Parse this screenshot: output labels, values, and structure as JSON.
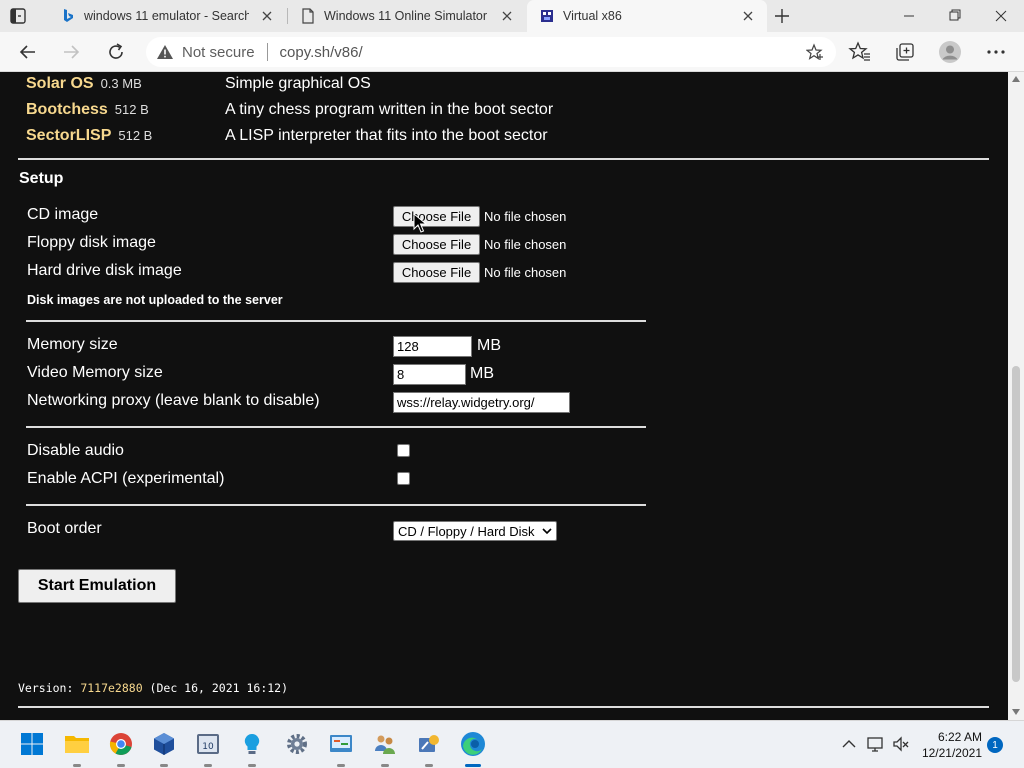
{
  "browser": {
    "tabs": [
      {
        "title": "windows 11 emulator - Search",
        "favicon": "bing-icon"
      },
      {
        "title": "Windows 11 Online Simulator - T",
        "favicon": "page-icon"
      },
      {
        "title": "Virtual x86",
        "favicon": "v86-icon"
      }
    ],
    "address": {
      "security_label": "Not secure",
      "url": "copy.sh/v86/"
    }
  },
  "os_list": [
    {
      "name": "Solar OS",
      "size": "0.3 MB",
      "description": "Simple graphical OS"
    },
    {
      "name": "Bootchess",
      "size": "512 B",
      "description": "A tiny chess program written in the boot sector"
    },
    {
      "name": "SectorLISP",
      "size": "512 B",
      "description": "A LISP interpreter that fits into the boot sector"
    }
  ],
  "setup": {
    "title": "Setup",
    "file_inputs": [
      {
        "label": "CD image",
        "button": "Choose File",
        "status": "No file chosen"
      },
      {
        "label": "Floppy disk image",
        "button": "Choose File",
        "status": "No file chosen"
      },
      {
        "label": "Hard drive disk image",
        "button": "Choose File",
        "status": "No file chosen"
      }
    ],
    "upload_note": "Disk images are not uploaded to the server",
    "memory": {
      "label": "Memory size",
      "value": "128",
      "unit": "MB"
    },
    "video_memory": {
      "label": "Video Memory size",
      "value": "8",
      "unit": "MB"
    },
    "proxy": {
      "label": "Networking proxy (leave blank to disable)",
      "value": "wss://relay.widgetry.org/"
    },
    "disable_audio": {
      "label": "Disable audio",
      "checked": false
    },
    "enable_acpi": {
      "label": "Enable ACPI (experimental)",
      "checked": false
    },
    "boot_order": {
      "label": "Boot order",
      "selected": "CD / Floppy / Hard Disk"
    },
    "start_button": "Start Emulation"
  },
  "version": {
    "prefix": "Version: ",
    "hash": "7117e2880",
    "date": " (Dec 16, 2021 16:12)"
  },
  "taskbar": {
    "time": "6:22 AM",
    "date": "12/21/2021",
    "notification_count": "1"
  },
  "colors": {
    "page_background": "#101010",
    "os_name": "#f7d88e",
    "accent": "#0067c0"
  }
}
